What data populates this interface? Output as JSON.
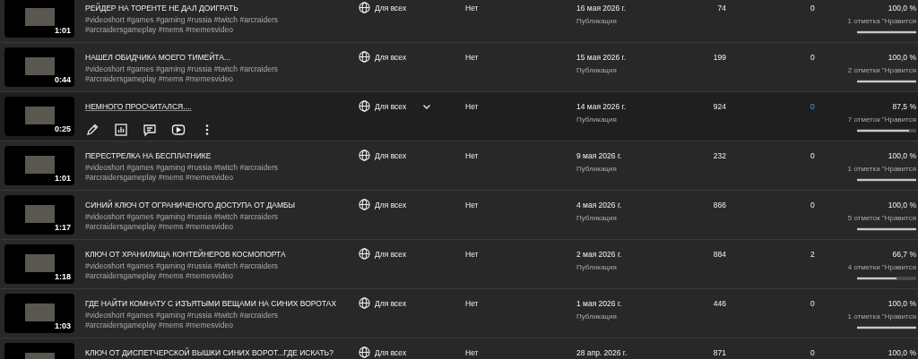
{
  "videos": [
    {
      "title": "РЕЙДЕР НА ТОРЕНТЕ НЕ ДАЛ ДОИГРАТЬ",
      "tags": "#videoshort #games #gaming #russia #twitch #arcraiders #arcraidersgameplay #mems #memesvideo",
      "duration": "1:01",
      "visibility": "Для всех",
      "restrictions": "Нет",
      "date": "16 мая 2026 г.",
      "date_label": "Публикация",
      "views": "74",
      "comments": "0",
      "like_percent": "100,0 %",
      "like_count": "1 отметка \"Нравится",
      "level": 1,
      "hovered": false
    },
    {
      "title": "НАШЕЛ ОБИДЧИКА МОЕГО ТИМЕЙТА...",
      "tags": "#videoshort #games #gaming #russia #twitch #arcraiders #arcraidersgameplay #mems #memesvideo",
      "duration": "0:44",
      "visibility": "Для всех",
      "restrictions": "Нет",
      "date": "15 мая 2026 г.",
      "date_label": "Публикация",
      "views": "199",
      "comments": "0",
      "like_percent": "100,0 %",
      "like_count": "2 отметки \"Нравится",
      "level": 1,
      "hovered": false
    },
    {
      "title": "НЕМНОГО ПРОСЧИТАЛСЯ....",
      "actions": [
        {
          "kind": "edit"
        },
        {
          "kind": "analytics"
        },
        {
          "kind": "comments"
        },
        {
          "kind": "play"
        },
        {
          "kind": "more"
        }
      ],
      "duration": "0:25",
      "visibility": "Для всех",
      "restrictions": "Нет",
      "date": "14 мая 2026 г.",
      "date_label": "Публикация",
      "views": "924",
      "comments": "0",
      "like_percent": "87,5 %",
      "like_count": "7 отметок \"Нравится",
      "level": 0.875,
      "hovered": true
    },
    {
      "title": "ПЕРЕСТРЕЛКА НА БЕСПЛАТНИКЕ",
      "tags": "#videoshort #games #gaming #russia #twitch #arcraiders #arcraidersgameplay #mems #memesvideo",
      "duration": "1:01",
      "visibility": "Для всех",
      "restrictions": "Нет",
      "date": "9 мая 2026 г.",
      "date_label": "Публикация",
      "views": "232",
      "comments": "0",
      "like_percent": "100,0 %",
      "like_count": "1 отметка \"Нравится",
      "level": 1,
      "hovered": false
    },
    {
      "title": "СИНИЙ КЛЮЧ ОТ ОГРАНИЧЕНОГО ДОСТУПА ОТ ДАМБЫ",
      "tags": "#videoshort #games #gaming #russia #twitch #arcraiders #arcraidersgameplay #mems #memesvideo",
      "duration": "1:17",
      "visibility": "Для всех",
      "restrictions": "Нет",
      "date": "4 мая 2026 г.",
      "date_label": "Публикация",
      "views": "866",
      "comments": "0",
      "like_percent": "100,0 %",
      "like_count": "5 отметок \"Нравится",
      "level": 1,
      "hovered": false
    },
    {
      "title": "КЛЮЧ ОТ ХРАНИЛИЩА КОНТЕЙНЕРОВ КОСМОПОРТА",
      "tags": "#videoshort #games #gaming #russia #twitch #arcraiders #arcraidersgameplay #mems #memesvideo",
      "duration": "1:18",
      "visibility": "Для всех",
      "restrictions": "Нет",
      "date": "2 мая 2026 г.",
      "date_label": "Публикация",
      "views": "884",
      "comments": "2",
      "like_percent": "66,7 %",
      "like_count": "4 отметки \"Нравится",
      "level": 0.667,
      "hovered": false
    },
    {
      "title": "ГДЕ НАЙТИ КОМНАТУ С ИЗЪЯТЫМИ ВЕЩАМИ НА СИНИХ ВОРОТАХ",
      "tags": "#videoshort #games #gaming #russia #twitch #arcraiders #arcraidersgameplay #mems #memesvideo",
      "duration": "1:03",
      "visibility": "Для всех",
      "restrictions": "Нет",
      "date": "1 мая 2026 г.",
      "date_label": "Публикация",
      "views": "446",
      "comments": "0",
      "like_percent": "100,0 %",
      "like_count": "1 отметка \"Нравится",
      "level": 1,
      "hovered": false
    },
    {
      "title": "КЛЮЧ ОТ ДИСПЕТЧЕРСКОЙ ВЫШКИ СИНИХ ВОРОТ...ГДЕ ИСКАТЬ?",
      "visibility": "Для всех",
      "restrictions": "Нет",
      "date": "28 апр. 2026 г.",
      "views": "871",
      "comments": "0",
      "like_percent": "100,0 %",
      "hovered": false
    }
  ]
}
